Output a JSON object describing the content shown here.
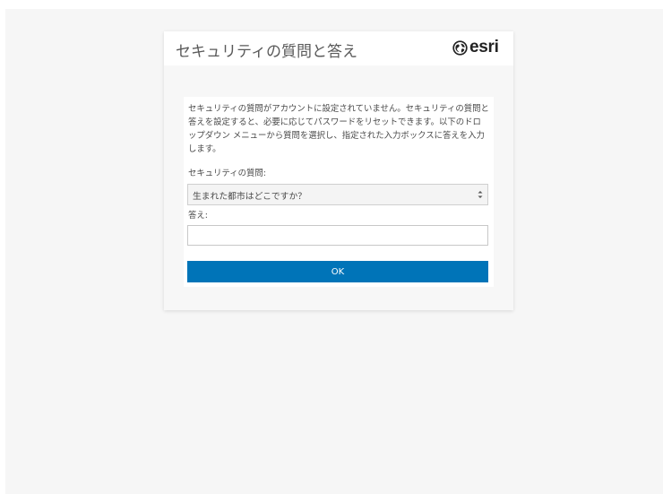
{
  "dialog": {
    "title": "セキュリティの質問と答え",
    "brand": {
      "text": "esri",
      "icon": "globe-icon"
    }
  },
  "form": {
    "instructions": "セキュリティの質問がアカウントに設定されていません。セキュリティの質問と答えを設定すると、必要に応じてパスワードをリセットできます。以下のドロップダウン メニューから質問を選択し、指定された入力ボックスに答えを入力します。",
    "question_label": "セキュリティの質問:",
    "question_selected": "生まれた都市はどこですか？",
    "answer_label": "答え:",
    "answer_value": "",
    "answer_placeholder": "",
    "ok_label": "OK"
  },
  "colors": {
    "primary_button": "#0074b8",
    "page_background": "#f6f6f6",
    "dialog_background": "#f7f7f7"
  }
}
